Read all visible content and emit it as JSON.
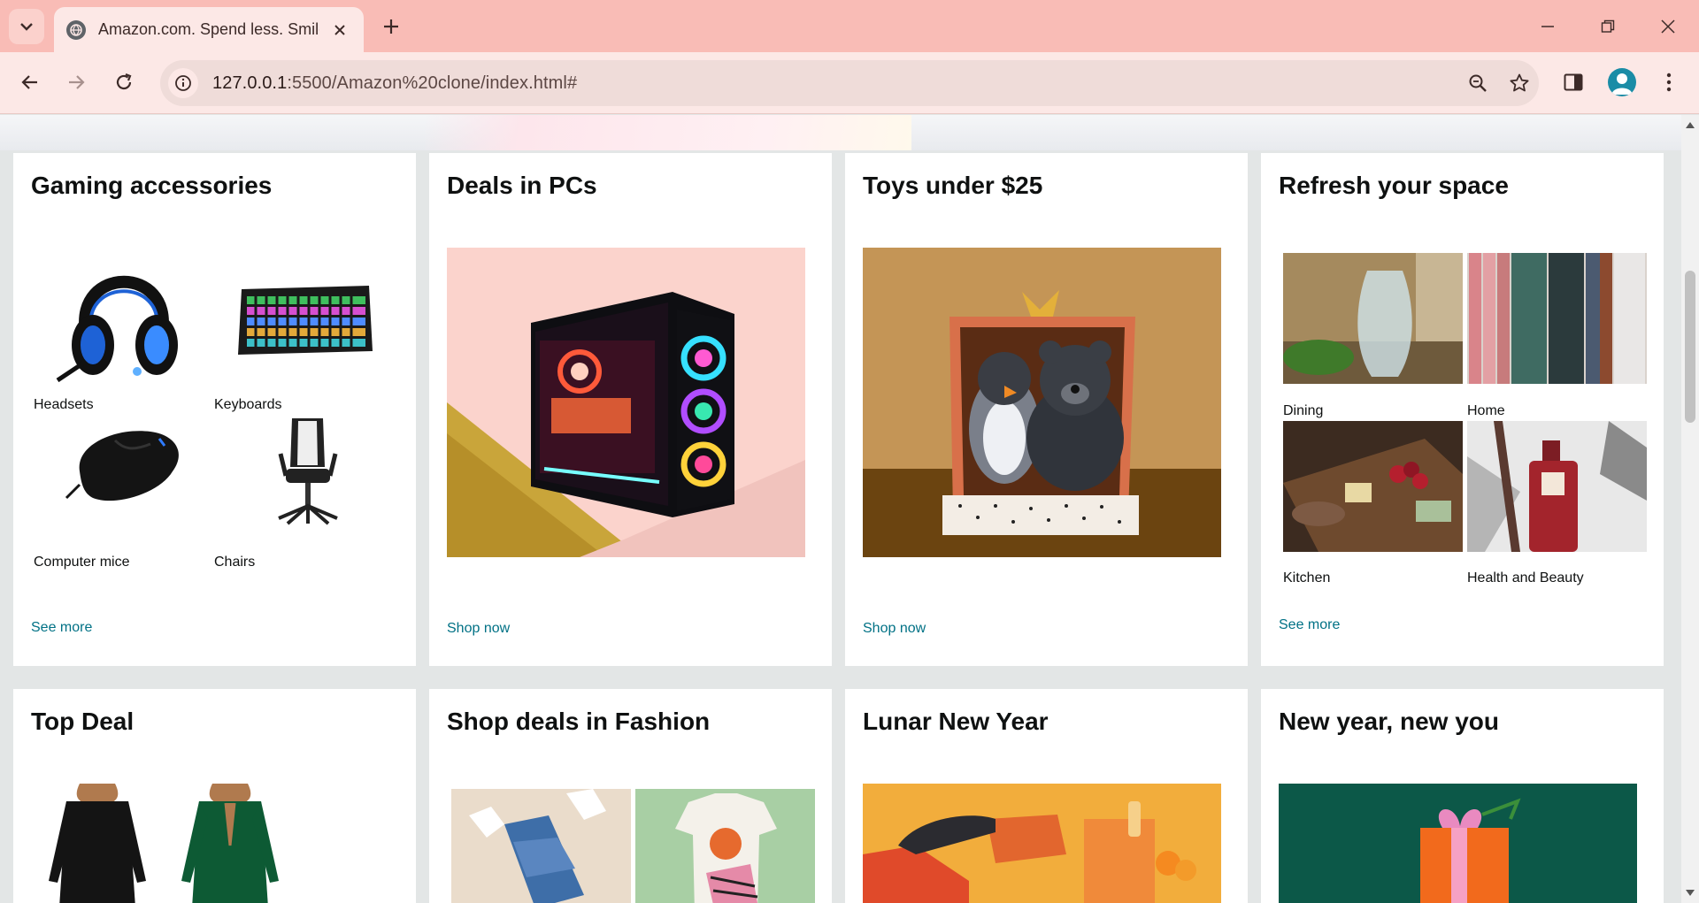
{
  "browser": {
    "tab_title": "Amazon.com. Spend less. Smile more.",
    "url_host": "127.0.0.1",
    "url_rest": ":5500/Amazon%20clone/index.html#"
  },
  "cards_row1": [
    {
      "title": "Gaming accessories",
      "link": "See more",
      "tiles": [
        "Headsets",
        "Keyboards",
        "Computer mice",
        "Chairs"
      ]
    },
    {
      "title": "Deals in PCs",
      "link": "Shop now"
    },
    {
      "title": "Toys under $25",
      "link": "Shop now"
    },
    {
      "title": "Refresh your space",
      "link": "See more",
      "tiles": [
        "Dining",
        "Home",
        "Kitchen",
        "Health and Beauty"
      ]
    }
  ],
  "cards_row2": [
    {
      "title": "Top Deal"
    },
    {
      "title": "Shop deals in Fashion"
    },
    {
      "title": "Lunar New Year"
    },
    {
      "title": "New year, new you"
    }
  ],
  "colors": {
    "link": "#007185",
    "tabstrip": "#f9bcb6",
    "toolbar": "#fce8e6",
    "page_bg": "#e3e6e6"
  }
}
